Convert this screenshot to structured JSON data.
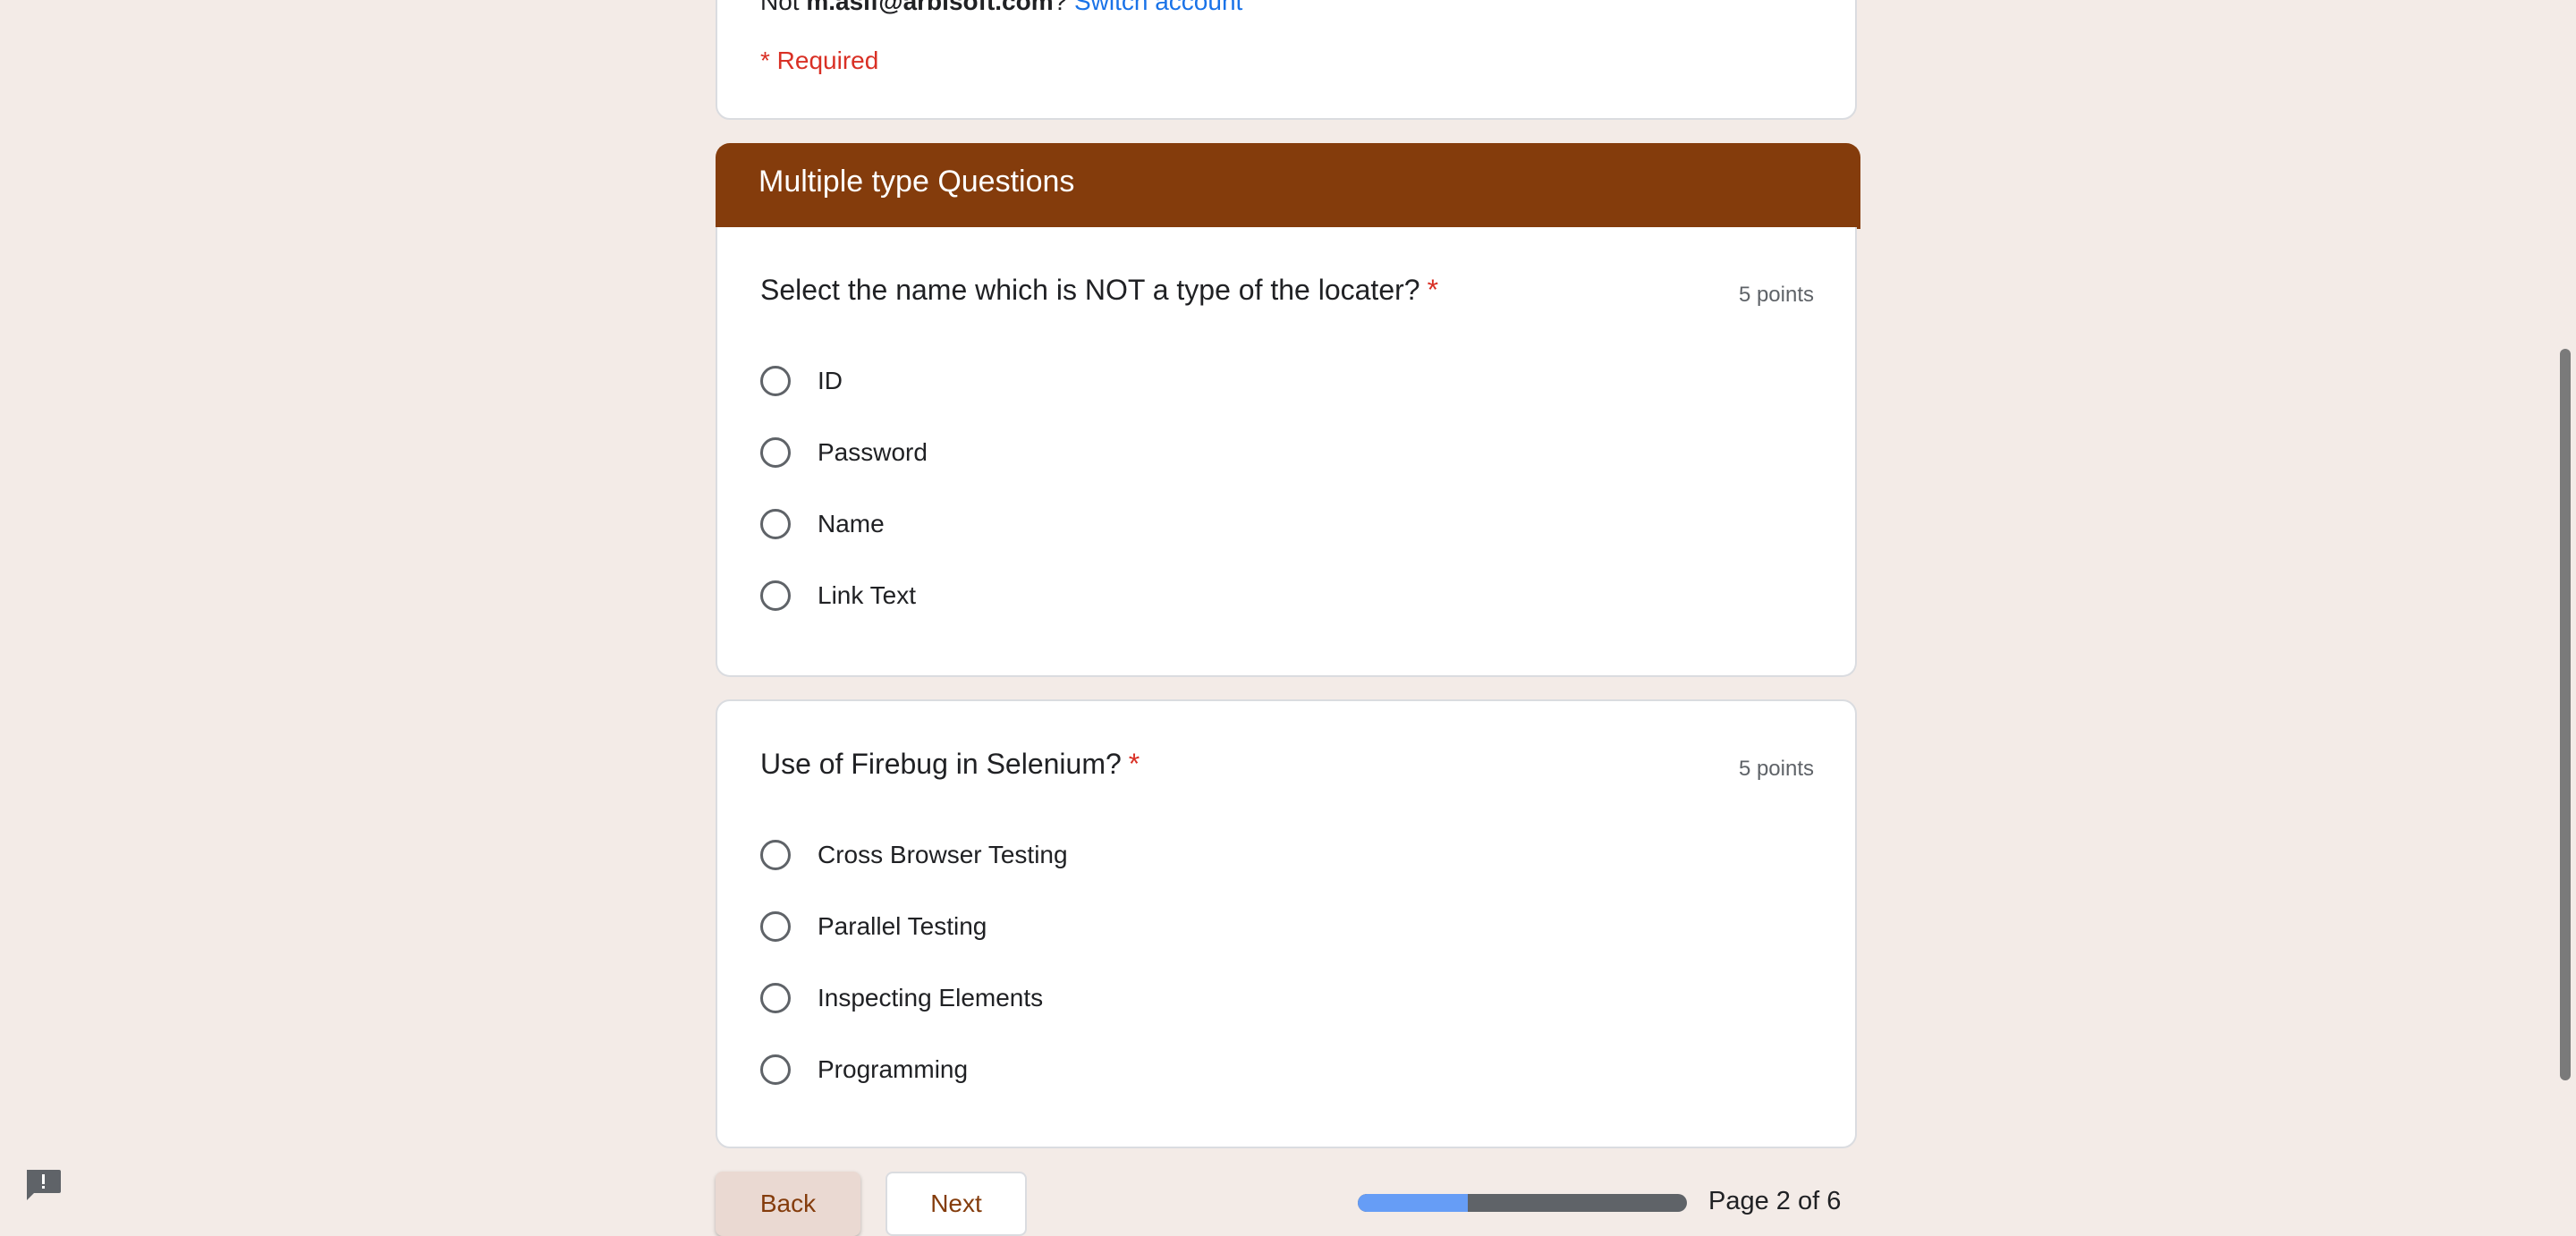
{
  "header_card": {
    "account_prefix": "Not ",
    "account_email": "m.asif@arbisoft.com",
    "account_suffix": "?",
    "switch_account": "Switch account",
    "required_note": "* Required"
  },
  "section": {
    "title": "Multiple type Questions"
  },
  "questions": [
    {
      "title": "Select the name which is NOT a type of the locater?",
      "required_mark": "*",
      "points": "5 points",
      "options": [
        "ID",
        "Password",
        "Name",
        "Link Text"
      ]
    },
    {
      "title": "Use of Firebug in Selenium?",
      "required_mark": "*",
      "points": "5 points",
      "options": [
        "Cross Browser Testing",
        "Parallel Testing",
        "Inspecting Elements",
        "Programming"
      ]
    }
  ],
  "navigation": {
    "back_label": "Back",
    "next_label": "Next",
    "page_indicator": "Page 2 of 6",
    "progress_fraction": 0.333
  },
  "icons": {
    "feedback": "feedback-icon"
  },
  "colors": {
    "accent": "#843c0c",
    "background": "#f3ebe7",
    "required": "#d93025",
    "link": "#1a73e8",
    "progress_fill": "#669df6",
    "progress_track": "#5f6368"
  }
}
